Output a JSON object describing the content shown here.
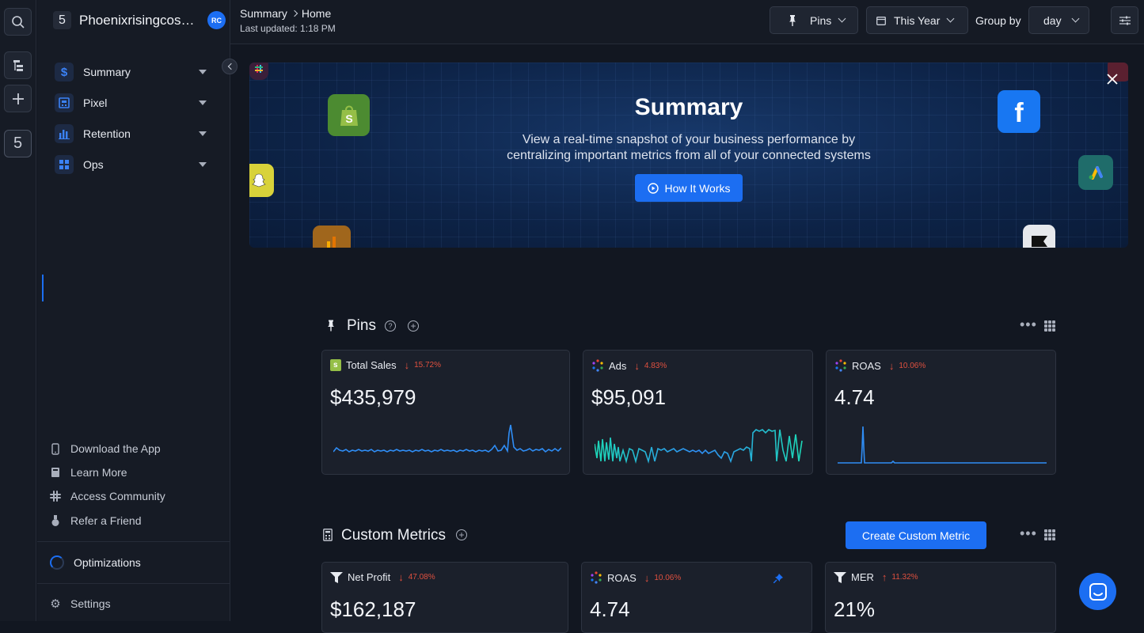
{
  "rail": {
    "workspace_num": "5"
  },
  "sidebar": {
    "shop_num": "5",
    "shop_name": "Phoenixrisingcosmetics",
    "avatar": "RC",
    "items": [
      {
        "label": "Summary",
        "icon": "dollar-icon"
      },
      {
        "label": "Pixel",
        "icon": "pixel-icon"
      },
      {
        "label": "Retention",
        "icon": "bar-chart-icon"
      },
      {
        "label": "Ops",
        "icon": "grid-icon"
      }
    ],
    "footer": [
      {
        "label": "Download the App",
        "icon": "phone-icon"
      },
      {
        "label": "Learn More",
        "icon": "book-icon"
      },
      {
        "label": "Access Community",
        "icon": "slack-icon"
      },
      {
        "label": "Refer a Friend",
        "icon": "medal-icon"
      }
    ],
    "optimizations": "Optimizations",
    "settings": "Settings"
  },
  "topbar": {
    "breadcrumb_root": "Summary",
    "breadcrumb_leaf": "Home",
    "last_updated": "Last updated: 1:18 PM",
    "pins_label": "Pins",
    "date_label": "This Year",
    "group_by_label": "Group by",
    "group_by_value": "day"
  },
  "banner": {
    "title": "Summary",
    "description": "View a real-time snapshot of your business performance by centralizing important metrics from all of your connected systems",
    "button": "How It Works"
  },
  "pins": {
    "title": "Pins",
    "cards": [
      {
        "label": "Total Sales",
        "delta": "15.72%",
        "value": "$435,979",
        "icon": "shopify-icon"
      },
      {
        "label": "Ads",
        "delta": "4.83%",
        "value": "$95,091",
        "icon": "ads-icon"
      },
      {
        "label": "ROAS",
        "delta": "10.06%",
        "value": "4.74",
        "icon": "roas-icon"
      }
    ]
  },
  "custom": {
    "title": "Custom Metrics",
    "create_button": "Create Custom Metric",
    "cards": [
      {
        "label": "Net Profit",
        "delta": "47.08%",
        "value": "$162,187",
        "icon": "funnel-icon"
      },
      {
        "label": "ROAS",
        "delta": "10.06%",
        "value": "4.74",
        "icon": "roas-icon"
      },
      {
        "label": "MER",
        "delta": "11.32%",
        "value": "21%",
        "icon": "funnel-icon"
      }
    ]
  },
  "colors": {
    "accent": "#1c6ef2",
    "negative": "#e0503f",
    "positive": "#e0503f"
  }
}
